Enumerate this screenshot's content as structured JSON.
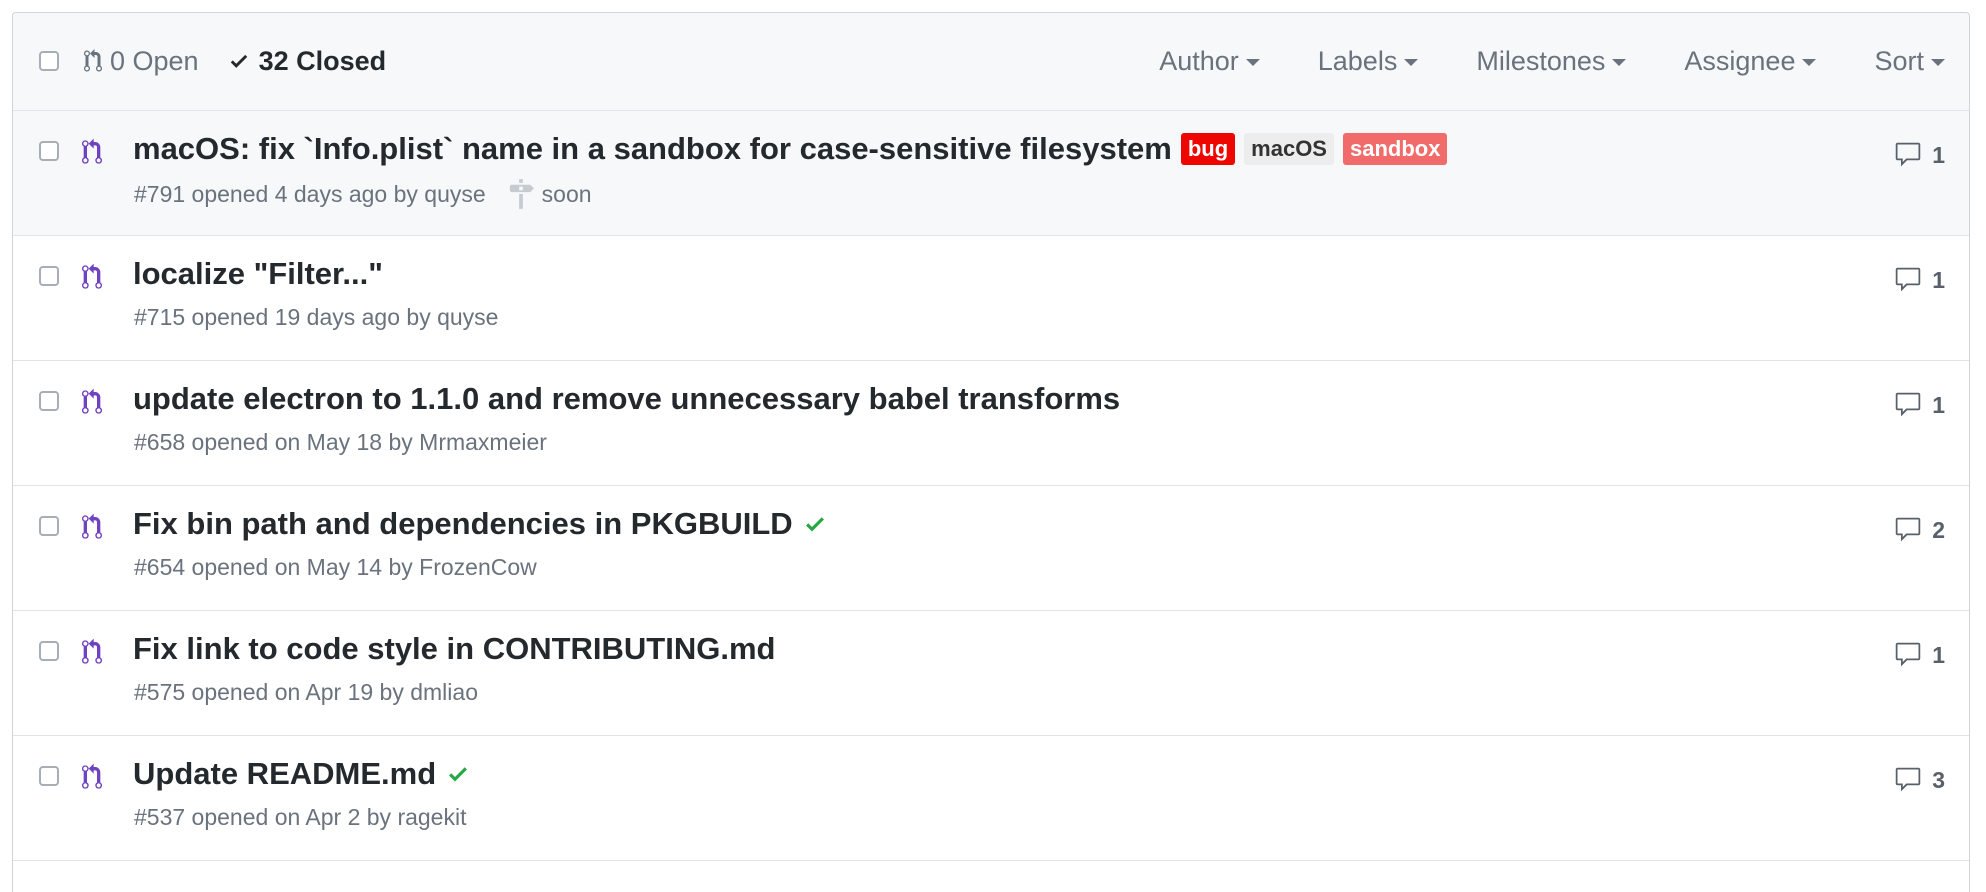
{
  "header": {
    "open_count_label": "0 Open",
    "closed_count_label": "32 Closed",
    "filters": [
      {
        "label": "Author",
        "name": "filter-author"
      },
      {
        "label": "Labels",
        "name": "filter-labels"
      },
      {
        "label": "Milestones",
        "name": "filter-milestones"
      },
      {
        "label": "Assignee",
        "name": "filter-assignee"
      },
      {
        "label": "Sort",
        "name": "filter-sort"
      }
    ]
  },
  "pulls": [
    {
      "title": "macOS: fix `Info.plist` name in a sandbox for case-sensitive filesystem",
      "meta": "#791 opened 4 days ago by quyse",
      "milestone": "soon",
      "labels": [
        {
          "text": "bug",
          "bg": "#ee0701",
          "fg": "#ffffff"
        },
        {
          "text": "macOS",
          "bg": "#ededed",
          "fg": "#333333"
        },
        {
          "text": "sandbox",
          "bg": "#f26b6b",
          "fg": "#ffffff"
        }
      ],
      "status_check": false,
      "comments": "1",
      "highlighted": true
    },
    {
      "title": "localize \"Filter...\"",
      "meta": "#715 opened 19 days ago by quyse",
      "milestone": "",
      "labels": [],
      "status_check": false,
      "comments": "1",
      "highlighted": false
    },
    {
      "title": "update electron to 1.1.0 and remove unnecessary babel transforms",
      "meta": "#658 opened on May 18 by Mrmaxmeier",
      "milestone": "",
      "labels": [],
      "status_check": false,
      "comments": "1",
      "highlighted": false
    },
    {
      "title": "Fix bin path and dependencies in PKGBUILD",
      "meta": "#654 opened on May 14 by FrozenCow",
      "milestone": "",
      "labels": [],
      "status_check": true,
      "comments": "2",
      "highlighted": false
    },
    {
      "title": "Fix link to code style in CONTRIBUTING.md",
      "meta": "#575 opened on Apr 19 by dmliao",
      "milestone": "",
      "labels": [],
      "status_check": false,
      "comments": "1",
      "highlighted": false
    },
    {
      "title": "Update README.md",
      "meta": "#537 opened on Apr 2 by ragekit",
      "milestone": "",
      "labels": [],
      "status_check": true,
      "comments": "3",
      "highlighted": false
    }
  ],
  "colors": {
    "pr_icon": "#6f42c1",
    "check_green": "#28a745",
    "muted_text": "#6a737d"
  }
}
